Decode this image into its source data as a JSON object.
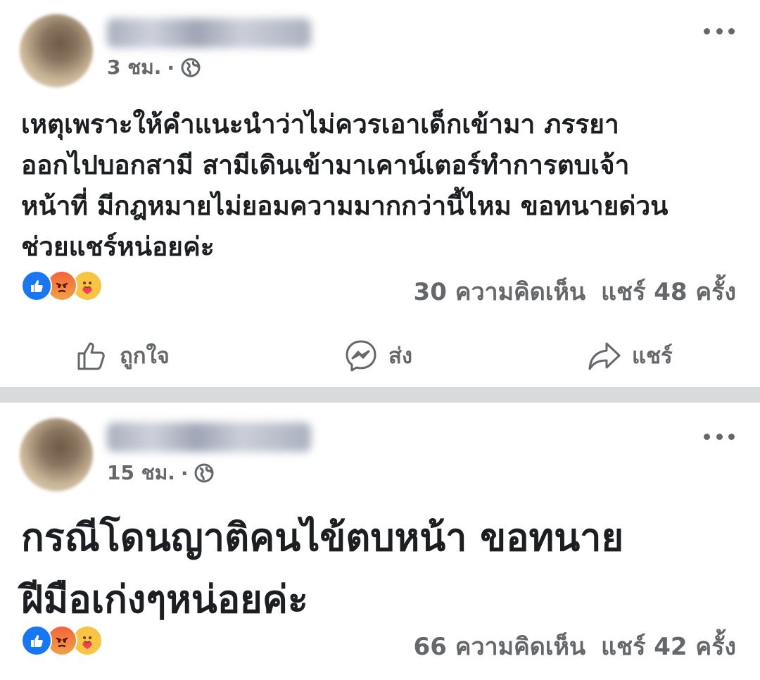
{
  "posts": [
    {
      "time": "3 ชม.",
      "separator": "·",
      "privacy_icon": "globe-icon",
      "text": "เหตุเพราะให้คำแนะนำว่าไม่ควรเอาเด็กเข้ามา   ภรรยา\nออกไปบอกสามี  สามีเดินเข้ามาเคาน์เตอร์ทำการตบเจ้า\nหน้าที่  มีกฎหมายไม่ยอมความมากกว่านี้ไหม  ขอทนายด่วน\nช่วยแชร์หน่อยค่ะ",
      "reactions": [
        "like-icon",
        "angry-icon",
        "care-icon"
      ],
      "comments": "30 ความคิดเห็น",
      "shares": "แชร์ 48 ครั้ง",
      "actions": {
        "like": "ถูกใจ",
        "send": "ส่ง",
        "share": "แชร์"
      }
    },
    {
      "time": "15 ชม.",
      "separator": "·",
      "privacy_icon": "globe-icon",
      "text": "กรณีโดนญาติคนไข้ตบหน้า  ขอทนาย\nฝีมือเก่งๆหน่อยค่ะ",
      "reactions": [
        "like-icon",
        "angry-icon",
        "care-icon"
      ],
      "comments": "66 ความคิดเห็น",
      "shares": "แชร์ 42 ครั้ง"
    }
  ],
  "colors": {
    "like_blue": "#1877f2",
    "secondary_text": "#65676b",
    "divider": "#d9dadc"
  }
}
